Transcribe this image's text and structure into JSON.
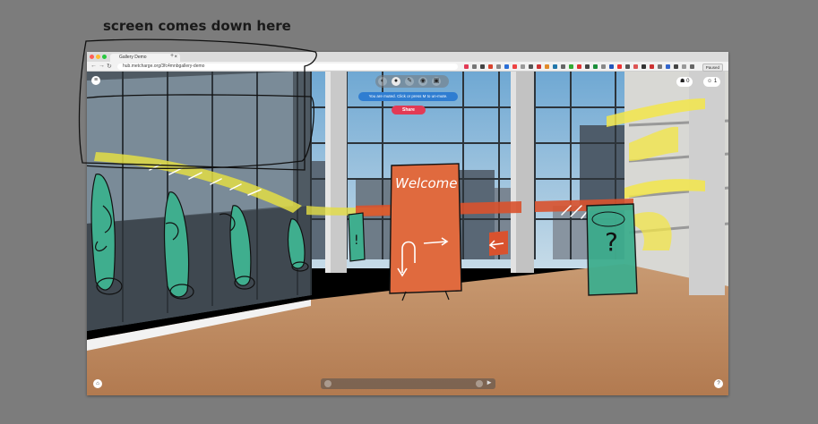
{
  "annotation": {
    "heading": "screen comes down here"
  },
  "browser": {
    "tab_title": "Gallery Demo",
    "tab_close_glyph": "×",
    "new_tab_glyph": "+",
    "url": "hub.metcharge.org/3fc4mnbgallery-demo",
    "profile_label": "Paused",
    "nav": {
      "back": "←",
      "forward": "→",
      "reload": "↻"
    },
    "traffic_lights": [
      "#ff5f57",
      "#febc2e",
      "#28c840"
    ]
  },
  "app": {
    "menu_glyph": "≡",
    "toolbar_icons": [
      "camera-icon",
      "microphone-icon",
      "pen-icon",
      "eye-icon",
      "object-icon"
    ],
    "notice": "You are muted. Click or press M to un-mute.",
    "share_label": "Share",
    "counters": [
      {
        "icon": "people-icon",
        "glyph": "☗",
        "value": "0"
      },
      {
        "icon": "users-icon",
        "glyph": "☺",
        "value": "1"
      }
    ],
    "chat_placeholder": "",
    "bottom_left_glyph": "⌂",
    "help_glyph": "?"
  },
  "scene": {
    "welcome_sign": "Welcome",
    "question_sign": "?",
    "exclamation_sign": "!",
    "colors": {
      "sign_orange": "#e06a3e",
      "sign_red": "#d9522e",
      "plant_green": "#3fae8e",
      "highlight_yellow": "#f3e64a",
      "floor": "#c89468",
      "sky": "#8fbfdc"
    }
  }
}
